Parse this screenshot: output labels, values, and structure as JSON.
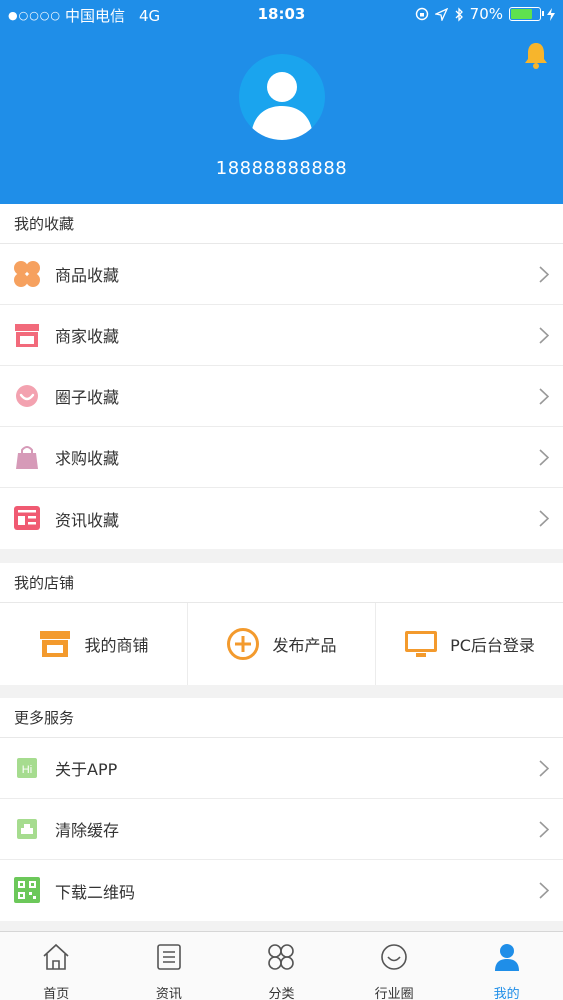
{
  "status_bar": {
    "signal": "●○○○○",
    "carrier": "中国电信",
    "network": "4G",
    "time": "18:03",
    "battery": "70%"
  },
  "profile": {
    "phone": "18888888888"
  },
  "favorites": {
    "title": "我的收藏",
    "items": [
      {
        "label": "商品收藏",
        "icon": "clover-icon",
        "color": "#f6a15f"
      },
      {
        "label": "商家收藏",
        "icon": "storefront-icon",
        "color": "#f26a7b"
      },
      {
        "label": "圈子收藏",
        "icon": "smile-circle-icon",
        "color": "#f08a9a"
      },
      {
        "label": "求购收藏",
        "icon": "shopping-bag-icon",
        "color": "#d69ab8"
      },
      {
        "label": "资讯收藏",
        "icon": "newspaper-icon",
        "color": "#f05a72"
      }
    ]
  },
  "store": {
    "title": "我的店铺",
    "items": [
      {
        "label": "我的商铺",
        "icon": "store-icon",
        "color": "#f39a2d"
      },
      {
        "label": "发布产品",
        "icon": "plus-circle-icon",
        "color": "#f39a2d"
      },
      {
        "label": "PC后台登录",
        "icon": "monitor-icon",
        "color": "#f39a2d"
      }
    ]
  },
  "services": {
    "title": "更多服务",
    "items": [
      {
        "label": "关于APP",
        "icon": "hi-icon",
        "color": "#8fd37a"
      },
      {
        "label": "清除缓存",
        "icon": "clear-cache-icon",
        "color": "#8fd37a"
      },
      {
        "label": "下载二维码",
        "icon": "qrcode-icon",
        "color": "#6cc85a"
      }
    ]
  },
  "tabbar": {
    "items": [
      {
        "label": "首页",
        "icon": "home-icon"
      },
      {
        "label": "资讯",
        "icon": "news-list-icon"
      },
      {
        "label": "分类",
        "icon": "category-icon"
      },
      {
        "label": "行业圈",
        "icon": "circle-smile-icon"
      },
      {
        "label": "我的",
        "icon": "user-icon",
        "active": true
      }
    ],
    "active_color": "#1f8ee8"
  },
  "colors": {
    "header": "#1f8ee8",
    "avatar_bg": "#1aa4ee",
    "bell": "#f7b52c"
  }
}
